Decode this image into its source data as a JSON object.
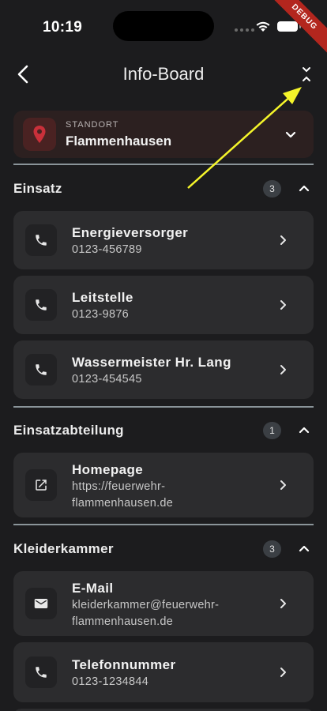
{
  "status_bar": {
    "time": "10:19",
    "debug": "DEBUG"
  },
  "app_bar": {
    "title": "Info-Board"
  },
  "location": {
    "label": "STANDORT",
    "value": "Flammenhausen"
  },
  "sections": [
    {
      "title": "Einsatz",
      "count": "3",
      "items": [
        {
          "title": "Energieversorger",
          "subtitle": "0123-456789",
          "icon": "phone-icon"
        },
        {
          "title": "Leitstelle",
          "subtitle": "0123-9876",
          "icon": "phone-icon"
        },
        {
          "title": "Wassermeister Hr. Lang",
          "subtitle": "0123-454545",
          "icon": "phone-icon"
        }
      ]
    },
    {
      "title": "Einsatzabteilung",
      "count": "1",
      "items": [
        {
          "title": "Homepage",
          "subtitle_lines": [
            "https://feuerwehr-",
            "flammenhausen.de"
          ],
          "icon": "open-in-new-icon"
        }
      ]
    },
    {
      "title": "Kleiderkammer",
      "count": "3",
      "items": [
        {
          "title": "E-Mail",
          "subtitle_lines": [
            "kleiderkammer@feuerwehr-",
            "flammenhausen.de"
          ],
          "icon": "mail-icon"
        },
        {
          "title": "Telefonnummer",
          "subtitle": "0123-1234844",
          "icon": "phone-icon"
        }
      ]
    }
  ],
  "colors": {
    "accent_location": "#c9303a",
    "annotation_arrow": "#f5f52a",
    "background": "#1c1c1e",
    "card": "#2c2c2e"
  }
}
